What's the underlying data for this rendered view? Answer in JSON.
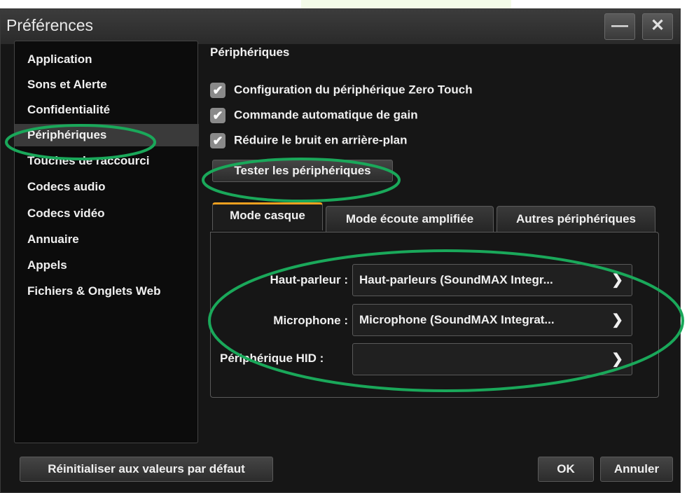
{
  "window": {
    "title": "Préférences",
    "minimize_icon": "minimize-icon",
    "close_icon": "close-icon"
  },
  "sidebar": {
    "items": [
      {
        "label": "Application"
      },
      {
        "label": "Sons et Alerte"
      },
      {
        "label": "Confidentialité"
      },
      {
        "label": "Périphériques",
        "selected": true
      },
      {
        "label": "Touches de raccourci"
      },
      {
        "label": "Codecs audio"
      },
      {
        "label": "Codecs vidéo"
      },
      {
        "label": "Annuaire"
      },
      {
        "label": "Appels"
      },
      {
        "label": "Fichiers & Onglets Web"
      }
    ]
  },
  "main": {
    "title": "Périphériques",
    "checkboxes": [
      {
        "label": "Configuration du périphérique Zero Touch",
        "checked": true
      },
      {
        "label": "Commande automatique de gain",
        "checked": true
      },
      {
        "label": "Réduire le bruit en arrière-plan",
        "checked": true
      }
    ],
    "test_button": "Tester les périphériques",
    "tabs": [
      {
        "label": "Mode casque",
        "active": true
      },
      {
        "label": "Mode écoute amplifiée"
      },
      {
        "label": "Autres périphériques"
      }
    ],
    "fields": [
      {
        "label": "Haut-parleur :",
        "value": "Haut-parleurs (SoundMAX Integr..."
      },
      {
        "label": "Microphone :",
        "value": "Microphone (SoundMAX Integrat..."
      },
      {
        "label": "Périphérique HID :",
        "value": ""
      }
    ]
  },
  "footer": {
    "reset_button": "Réinitialiser aux valeurs par défaut",
    "ok_button": "OK",
    "cancel_button": "Annuler"
  },
  "colors": {
    "background": "#161616",
    "annotation": "#1aa85a",
    "active_tab_accent": "#f0a020"
  }
}
